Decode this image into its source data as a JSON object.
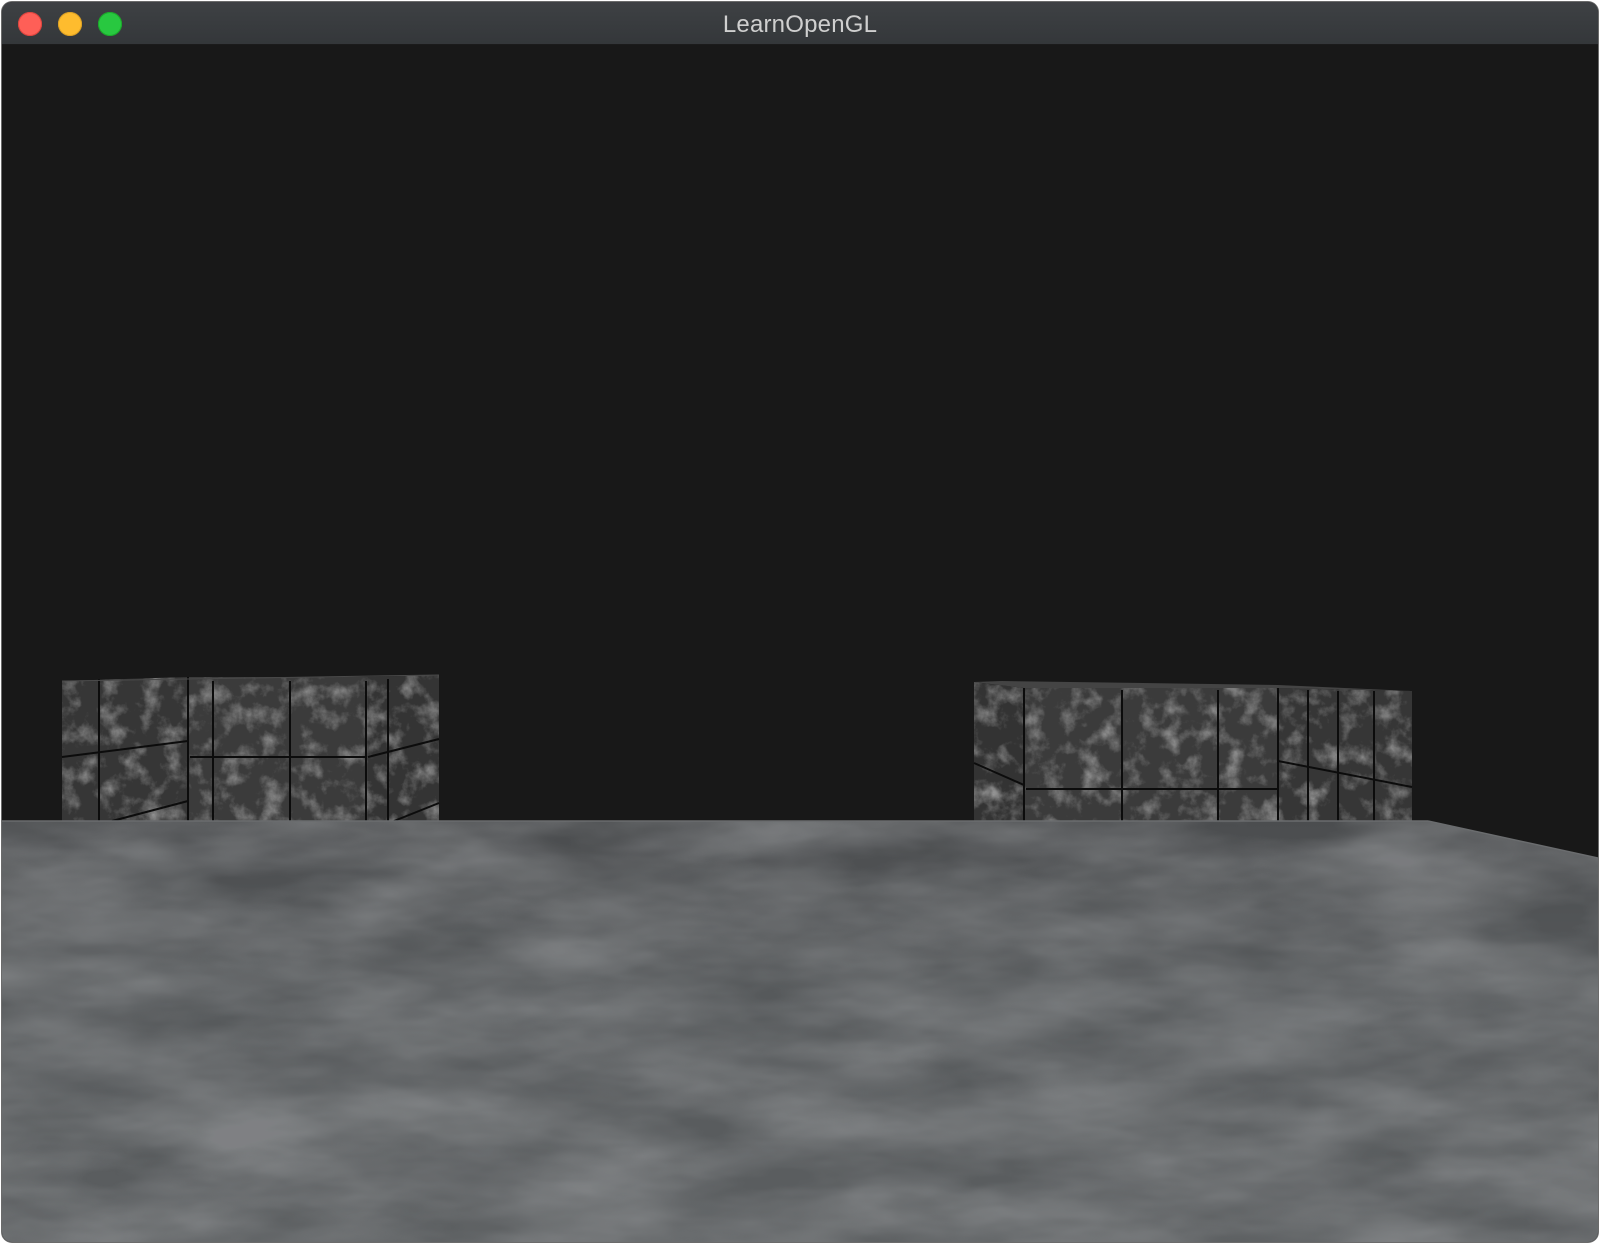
{
  "window": {
    "title": "LearnOpenGL",
    "buttons": [
      {
        "name": "close",
        "color": "#fe5f57"
      },
      {
        "name": "minimize",
        "color": "#febc2e"
      },
      {
        "name": "maximize",
        "color": "#28c840"
      }
    ]
  },
  "scene": {
    "clear_color": "#181818",
    "floor_color": "#5a5c5e",
    "cube_color": "#3c3c3c",
    "objects": [
      "marble-cube-left",
      "marble-cube-right",
      "metal-floor-plane"
    ]
  }
}
